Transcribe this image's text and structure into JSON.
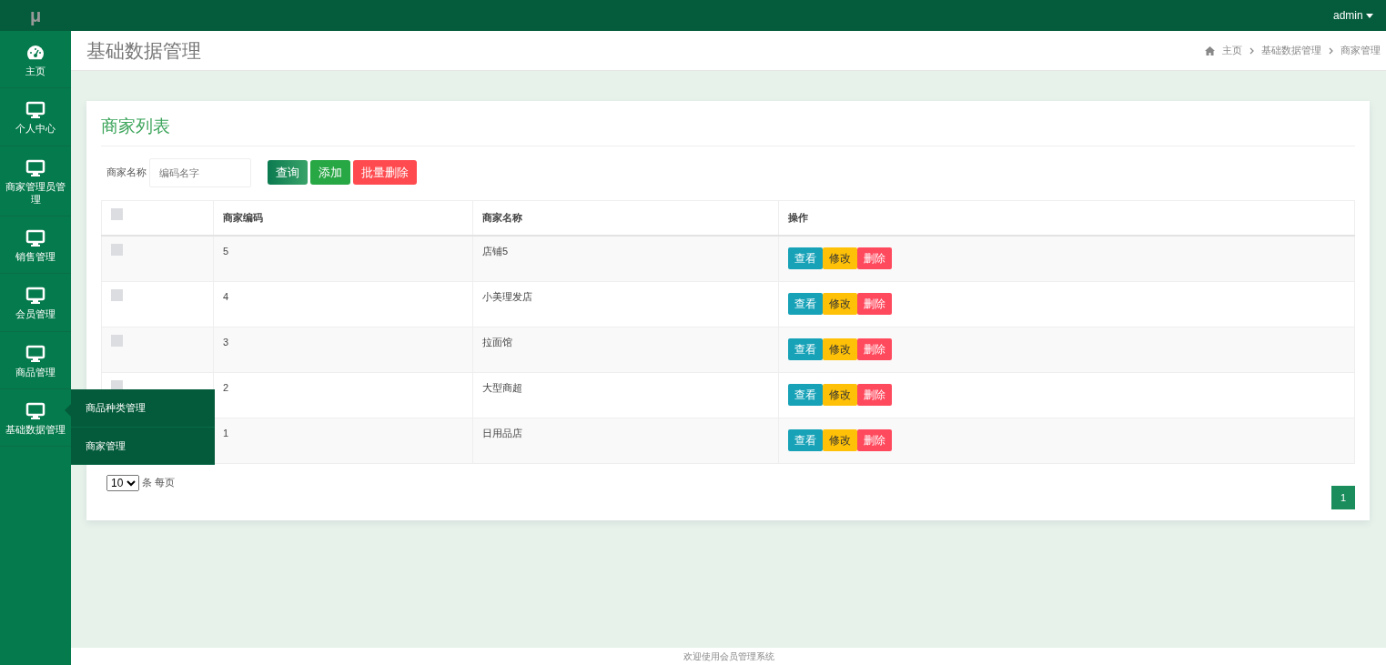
{
  "logo": "μ",
  "user_menu": {
    "label": "admin"
  },
  "sidebar": {
    "items": [
      {
        "label": "主页",
        "kind": "home"
      },
      {
        "label": "个人中心",
        "kind": "monitor"
      },
      {
        "label": "商家管理员管理",
        "kind": "monitor"
      },
      {
        "label": "销售管理",
        "kind": "monitor"
      },
      {
        "label": "会员管理",
        "kind": "monitor"
      },
      {
        "label": "商品管理",
        "kind": "monitor"
      },
      {
        "label": "基础数据管理",
        "kind": "monitor",
        "children": [
          {
            "label": "商品种类管理"
          },
          {
            "label": "商家管理"
          }
        ]
      }
    ]
  },
  "page_title": "基础数据管理",
  "breadcrumb": [
    "主页",
    "基础数据管理",
    "商家管理"
  ],
  "card": {
    "title": "商家列表",
    "search": {
      "label": "商家名称",
      "placeholder": "编码名字"
    },
    "buttons": [
      {
        "label": "查询",
        "kind": "query"
      },
      {
        "label": "添加",
        "kind": "add"
      },
      {
        "label": "批量删除",
        "kind": "delete"
      }
    ],
    "table": {
      "select_all_checked": false,
      "columns": [
        "商家编码",
        "商家名称",
        "操作"
      ],
      "rows": [
        {
          "checked": false,
          "code": "5",
          "name": "店铺5",
          "actions": [
            "查看",
            "修改",
            "删除"
          ]
        },
        {
          "checked": false,
          "code": "4",
          "name": "小美理发店",
          "actions": [
            "查看",
            "修改",
            "删除"
          ]
        },
        {
          "checked": false,
          "code": "3",
          "name": "拉面馆",
          "actions": [
            "查看",
            "修改",
            "删除"
          ]
        },
        {
          "checked": false,
          "code": "2",
          "name": "大型商超",
          "actions": [
            "查看",
            "修改",
            "删除"
          ]
        },
        {
          "code": "1",
          "name": "日用品店",
          "actions": [
            "查看",
            "修改",
            "删除"
          ]
        }
      ]
    },
    "page_size": {
      "value": "10",
      "suffix": "条 每页"
    },
    "pagination": [
      {
        "label": "1",
        "selected": true
      }
    ]
  },
  "footer": "欢迎使用会员管理系统"
}
